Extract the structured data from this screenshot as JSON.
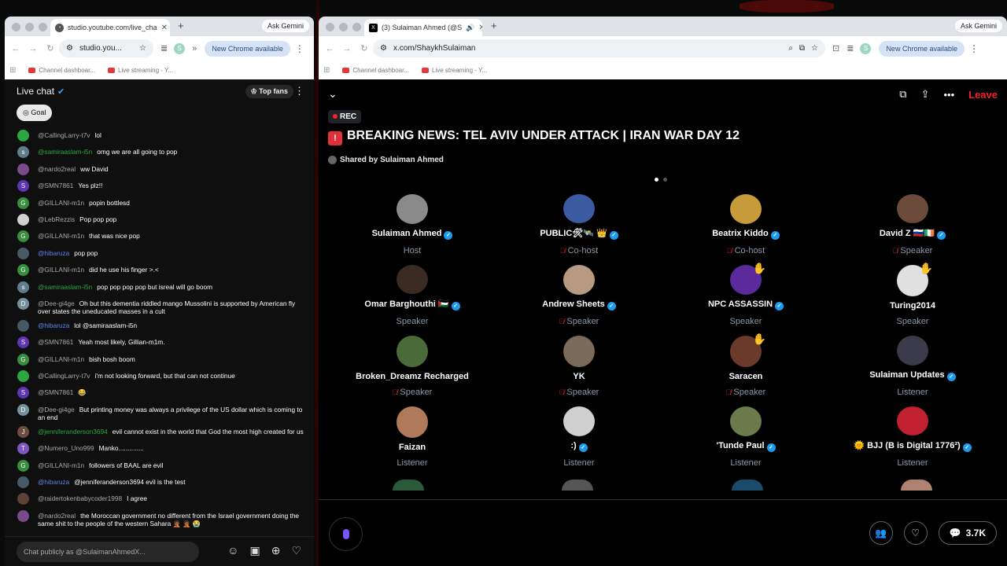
{
  "left_window": {
    "tab_title": "studio.youtube.com/live_cha",
    "ask_gemini": "Ask Gemini",
    "url": "studio.you...",
    "new_chrome": "New Chrome available",
    "bookmarks": [
      "Channel dashboar...",
      "Live streaming - Y..."
    ],
    "chat": {
      "title": "Live chat",
      "top_fans": "Top fans",
      "goal": "Goal",
      "input_placeholder": "Chat publicly as @SulaimanAhmedX...",
      "messages": [
        {
          "author": "@CallingLarry-t7v",
          "text": "lol",
          "color": "#2ba640",
          "initial": "",
          "name_style": "gray"
        },
        {
          "author": "@samiraaslam-i5n",
          "text": "omg we are all going to pop",
          "color": "#607d8b",
          "initial": "s",
          "name_style": "green"
        },
        {
          "author": "@nardo2real",
          "text": "ww David",
          "color": "#7b4a8a",
          "initial": "",
          "name_style": "gray"
        },
        {
          "author": "@SMN7861",
          "text": "Yes plz!!",
          "color": "#5e35b1",
          "initial": "S",
          "name_style": "gray"
        },
        {
          "author": "@GILLANI-m1n",
          "text": "popin bottlesd",
          "color": "#388e3c",
          "initial": "G",
          "name_style": "gray"
        },
        {
          "author": "@LebRezzis",
          "text": "Pop pop pop",
          "color": "#cfcfcf",
          "initial": "",
          "name_style": "gray"
        },
        {
          "author": "@GILLANI-m1n",
          "text": "that was nice pop",
          "color": "#388e3c",
          "initial": "G",
          "name_style": "gray"
        },
        {
          "author": "@hibaruza",
          "text": "pop pop",
          "color": "#455a64",
          "initial": "",
          "name_style": "blue"
        },
        {
          "author": "@GILLANI-m1n",
          "text": "did he use his finger >.<",
          "color": "#388e3c",
          "initial": "G",
          "name_style": "gray"
        },
        {
          "author": "@samiraaslam-i5n",
          "text": "pop pop pop pop but isreal will go boom",
          "color": "#607d8b",
          "initial": "s",
          "name_style": "green"
        },
        {
          "author": "@Dee-gi4ge",
          "text": "Oh but this dementia riddled mango Mussolini is supported by American fly over states the uneducated masses in a cult",
          "color": "#78909c",
          "initial": "D",
          "name_style": "gray"
        },
        {
          "author": "@hibaruza",
          "text": "lol @samiraaslam-i5n",
          "color": "#455a64",
          "initial": "",
          "name_style": "blue"
        },
        {
          "author": "@SMN7861",
          "text": "Yeah most likely, Gillian-m1m.",
          "color": "#5e35b1",
          "initial": "S",
          "name_style": "gray"
        },
        {
          "author": "@GILLANI-m1n",
          "text": "bish bosh boom",
          "color": "#388e3c",
          "initial": "G",
          "name_style": "gray"
        },
        {
          "author": "@CallingLarry-t7v",
          "text": "i'm not looking forward, but that can not continue",
          "color": "#2ba640",
          "initial": "",
          "name_style": "gray"
        },
        {
          "author": "@SMN7861",
          "text": "😂",
          "color": "#5e35b1",
          "initial": "S",
          "name_style": "gray"
        },
        {
          "author": "@Dee-gi4ge",
          "text": "But printing money was always a privilege of the US dollar which is coming to an end",
          "color": "#78909c",
          "initial": "D",
          "name_style": "gray"
        },
        {
          "author": "@jenniferanderson3694",
          "text": "evil cannot exist in the world that God the most high created for us",
          "color": "#6d4c41",
          "initial": "J",
          "name_style": "green"
        },
        {
          "author": "@Numero_Uno999",
          "text": "Manko..............",
          "color": "#7e57c2",
          "initial": "T",
          "name_style": "gray"
        },
        {
          "author": "@GILLANI-m1n",
          "text": "followers of BAAL are evil",
          "color": "#388e3c",
          "initial": "G",
          "name_style": "gray"
        },
        {
          "author": "@hibaruza",
          "text": "@jenniferanderson3694 evil is the test",
          "color": "#455a64",
          "initial": "",
          "name_style": "blue"
        },
        {
          "author": "@raidertokenbabycoder1998",
          "text": "I agree",
          "color": "#5d4037",
          "initial": "",
          "name_style": "gray"
        },
        {
          "author": "@nardo2real",
          "text": "the Moroccan government no different from the Israel government doing the same shit to the people of the western Sahara 🤦🏾 🤦🏾 😭",
          "color": "#7b4a8a",
          "initial": "",
          "name_style": "gray"
        }
      ]
    }
  },
  "right_window": {
    "tab_title": "(3) Sulaiman Ahmed (@S",
    "ask_gemini": "Ask Gemini",
    "url": "x.com/ShaykhSulaiman",
    "new_chrome": "New Chrome available",
    "bookmarks": [
      "Channel dashboar...",
      "Live streaming - Y..."
    ],
    "space": {
      "leave": "Leave",
      "rec": "REC",
      "title": "BREAKING NEWS: TEL AVIV UNDER ATTACK | IRAN WAR DAY 12",
      "shared_by": "Shared by Sulaiman Ahmed",
      "listener_count": "3.7K",
      "participants": [
        {
          "name": "Sulaiman Ahmed",
          "role": "Host",
          "verified": true,
          "muted": false,
          "hand": false,
          "color": "#8a8a8a"
        },
        {
          "name": "PUBLIC🛠🛰️ 👑",
          "role": "Co-host",
          "verified": true,
          "muted": true,
          "hand": false,
          "color": "#3b5aa0"
        },
        {
          "name": "Beatrix Kiddo",
          "role": "Co-host",
          "verified": true,
          "muted": true,
          "hand": false,
          "color": "#c79a3a"
        },
        {
          "name": "David Z 🇷🇺🇮🇪",
          "role": "Speaker",
          "verified": true,
          "muted": true,
          "hand": false,
          "color": "#6b4a3a"
        },
        {
          "name": "Omar Barghouthi 🇵🇸",
          "role": "Speaker",
          "verified": true,
          "muted": false,
          "hand": false,
          "color": "#3a2a22"
        },
        {
          "name": "Andrew Sheets",
          "role": "Speaker",
          "verified": true,
          "muted": true,
          "hand": false,
          "color": "#b89a80"
        },
        {
          "name": "NPC ASSASSIN",
          "role": "Speaker",
          "verified": true,
          "muted": false,
          "hand": true,
          "color": "#5a2a9a"
        },
        {
          "name": "Turing2014",
          "role": "Speaker",
          "verified": false,
          "muted": false,
          "hand": true,
          "color": "#e0e0e0"
        },
        {
          "name": "Broken_Dreamz Recharged",
          "role": "Speaker",
          "verified": false,
          "muted": true,
          "hand": false,
          "color": "#4a6a3a"
        },
        {
          "name": "YK",
          "role": "Speaker",
          "verified": false,
          "muted": true,
          "hand": false,
          "color": "#7a6a5a"
        },
        {
          "name": "Saracen",
          "role": "Speaker",
          "verified": false,
          "muted": true,
          "hand": true,
          "color": "#6a3a2a"
        },
        {
          "name": "Sulaiman Updates",
          "role": "Listener",
          "verified": true,
          "muted": false,
          "hand": false,
          "color": "#3a3a4a"
        },
        {
          "name": "Faizan",
          "role": "Listener",
          "verified": false,
          "muted": false,
          "hand": false,
          "color": "#b07a5a"
        },
        {
          "name": ":)",
          "role": "Listener",
          "verified": true,
          "muted": false,
          "hand": false,
          "color": "#d0d0d0"
        },
        {
          "name": "'Tunde Paul",
          "role": "Listener",
          "verified": true,
          "muted": false,
          "hand": false,
          "color": "#6a7a4a"
        },
        {
          "name": "🌞 BJJ (B is Digital 1776²)",
          "role": "Listener",
          "verified": true,
          "muted": false,
          "hand": false,
          "color": "#c02030"
        }
      ]
    }
  }
}
